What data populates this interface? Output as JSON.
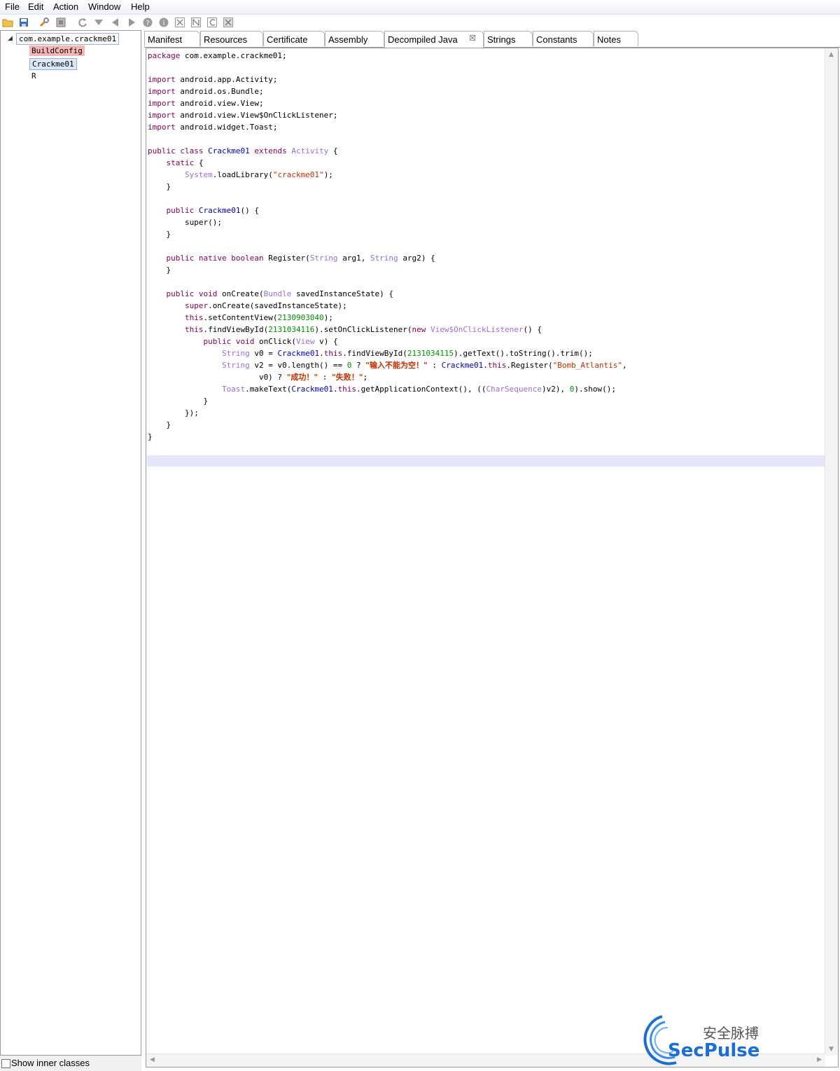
{
  "menu": [
    "File",
    "Edit",
    "Action",
    "Window",
    "Help"
  ],
  "toolbar": {
    "icons": [
      "open-folder-icon",
      "save-icon",
      "wrench-icon",
      "settings-icon",
      "refresh-icon",
      "dropdown-icon",
      "back-icon",
      "forward-icon",
      "help-icon",
      "info-icon",
      "x-icon",
      "n-icon",
      "c-icon",
      "x-box-icon"
    ]
  },
  "tree": {
    "root": "com.example.crackme01",
    "children": [
      "BuildConfig",
      "Crackme01",
      "R"
    ]
  },
  "bottom": {
    "show_inner_classes": "Show inner classes"
  },
  "tabs": [
    "Manifest",
    "Resources",
    "Certificate",
    "Assembly",
    "Decompiled Java",
    "Strings",
    "Constants",
    "Notes"
  ],
  "active_tab": "Decompiled Java",
  "code": {
    "package_kw": "package",
    "package_name": " com.example.crackme01;",
    "imports": [
      "android.app.Activity;",
      "android.os.Bundle;",
      "android.view.View;",
      "android.view.View$OnClickListener;",
      "android.widget.Toast;"
    ],
    "import_kw": "import",
    "class_name": "Crackme01",
    "super_class": "Activity",
    "lib_name": "\"crackme01\"",
    "register_arg1": "arg1",
    "register_arg2": "arg2",
    "layout_id": "2130903040",
    "button_id": "2131034116",
    "edit_id": "2131034115",
    "msg_empty": "\"输入不能为空！\"",
    "reg_key": "\"Bomb_Atlantis\"",
    "msg_ok": "\"成功！\"",
    "msg_fail": "\"失败！\""
  },
  "watermark": {
    "cn": "安全脉搏",
    "en": "SecPulse"
  },
  "colors": {
    "keyword": "#7f0055",
    "class_ref": "#0000c0",
    "lib_class": "#9a6dd7",
    "string": "#c03000",
    "number": "#009000"
  }
}
